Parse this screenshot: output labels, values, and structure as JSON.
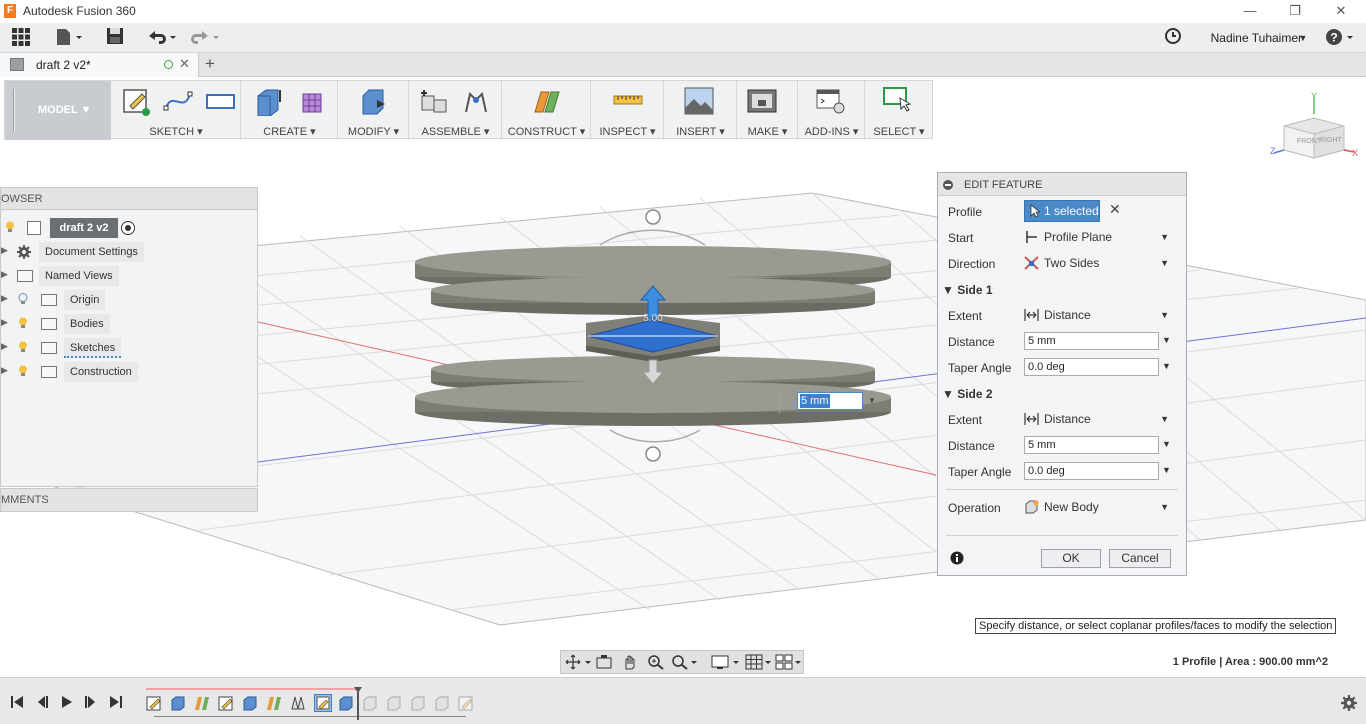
{
  "window": {
    "title": "Autodesk Fusion 360",
    "min": "—",
    "restore": "❐",
    "close": "✕"
  },
  "qat": {
    "user": "Nadine Tuhaimer",
    "help": "?"
  },
  "doc_tab": {
    "label": "draft 2 v2*"
  },
  "ribbon": {
    "workspace": "MODEL",
    "groups": [
      "SKETCH",
      "CREATE",
      "MODIFY",
      "ASSEMBLE",
      "CONSTRUCT",
      "INSPECT",
      "INSERT",
      "MAKE",
      "ADD-INS",
      "SELECT"
    ]
  },
  "viewcube": {
    "front": "FRONT",
    "right": "RIGHT",
    "x": "X",
    "y": "Y",
    "z": "Z"
  },
  "browser": {
    "header": "OWSER",
    "root": "draft 2 v2",
    "items": [
      "Document Settings",
      "Named Views",
      "Origin",
      "Bodies",
      "Sketches",
      "Construction"
    ],
    "comments": "MMENTS"
  },
  "edit_feature": {
    "title": "EDIT FEATURE",
    "profile_label": "Profile",
    "profile_value": "1 selected",
    "start_label": "Start",
    "start_value": "Profile Plane",
    "direction_label": "Direction",
    "direction_value": "Two Sides",
    "side1": {
      "title": "Side 1",
      "extent_label": "Extent",
      "extent_value": "Distance",
      "distance_label": "Distance",
      "distance_value": "5 mm",
      "taper_label": "Taper Angle",
      "taper_value": "0.0 deg"
    },
    "side2": {
      "title": "Side 2",
      "extent_label": "Extent",
      "extent_value": "Distance",
      "distance_label": "Distance",
      "distance_value": "5 mm",
      "taper_label": "Taper Angle",
      "taper_value": "0.0 deg"
    },
    "operation_label": "Operation",
    "operation_value": "New Body",
    "ok": "OK",
    "cancel": "Cancel"
  },
  "canvas": {
    "inline_distance": "5 mm",
    "manip_label": "5.00"
  },
  "tooltip": "Specify distance, or select coplanar profiles/faces to modify the selection",
  "status": "1 Profile | Area : 900.00 mm^2",
  "colors": {
    "accent": "#4a8ac8",
    "selected_face": "#2f6fcf",
    "body": "#8a8a80"
  }
}
